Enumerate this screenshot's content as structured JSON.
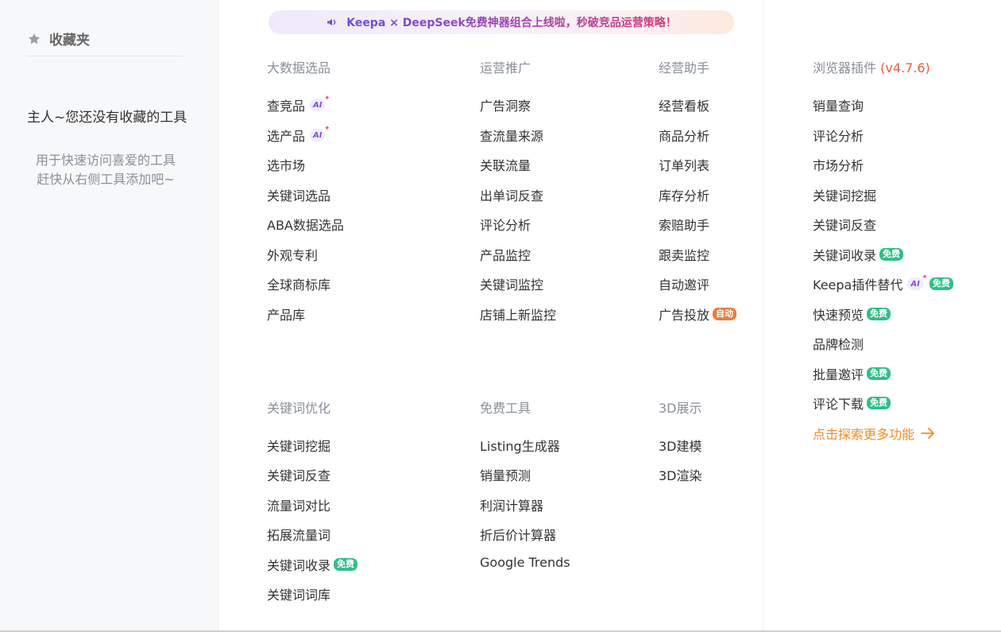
{
  "sidebar": {
    "title": "收藏夹",
    "empty_title": "主人~您还没有收藏的工具",
    "empty_desc_line1": "用于快速访问喜爱的工具",
    "empty_desc_line2": "赶快从右侧工具添加吧~"
  },
  "banner": {
    "text": "Keepa × DeepSeek免费神器组合上线啦，秒破竞品运营策略！"
  },
  "tags": {
    "ai": "AI",
    "free": "免费",
    "auto": "自动"
  },
  "sections": {
    "big_data": {
      "title": "大数据选品",
      "items": [
        "查竞品",
        "选产品",
        "选市场",
        "关键词选品",
        "ABA数据选品",
        "外观专利",
        "全球商标库",
        "产品库"
      ]
    },
    "promotion": {
      "title": "运营推广",
      "items": [
        "广告洞察",
        "查流量来源",
        "关联流量",
        "出单词反查",
        "评论分析",
        "产品监控",
        "关键词监控",
        "店铺上新监控"
      ]
    },
    "assistant": {
      "title": "经营助手",
      "items": [
        "经营看板",
        "商品分析",
        "订单列表",
        "库存分析",
        "索赔助手",
        "跟卖监控",
        "自动邀评",
        "广告投放"
      ]
    },
    "keyword_opt": {
      "title": "关键词优化",
      "items": [
        "关键词挖掘",
        "关键词反查",
        "流量词对比",
        "拓展流量词",
        "关键词收录",
        "关键词词库"
      ]
    },
    "free_tools": {
      "title": "免费工具",
      "items": [
        "Listing生成器",
        "销量预测",
        "利润计算器",
        "折后价计算器",
        "Google Trends"
      ]
    },
    "display_3d": {
      "title": "3D展示",
      "items": [
        "3D建模",
        "3D渲染"
      ]
    },
    "plugin": {
      "title": "浏览器插件",
      "version": "(v4.7.6)",
      "items": [
        "销量查询",
        "评论分析",
        "市场分析",
        "关键词挖掘",
        "关键词反查",
        "关键词收录",
        "Keepa插件替代",
        "快速预览",
        "品牌检测",
        "批量邀评",
        "评论下载"
      ],
      "explore": "点击探索更多功能"
    }
  },
  "colors": {
    "accent": "#f08a24",
    "free": "#2fbf86",
    "auto": "#f07a3c",
    "ai": "#7b4fe6",
    "version": "#ee5a3c"
  }
}
